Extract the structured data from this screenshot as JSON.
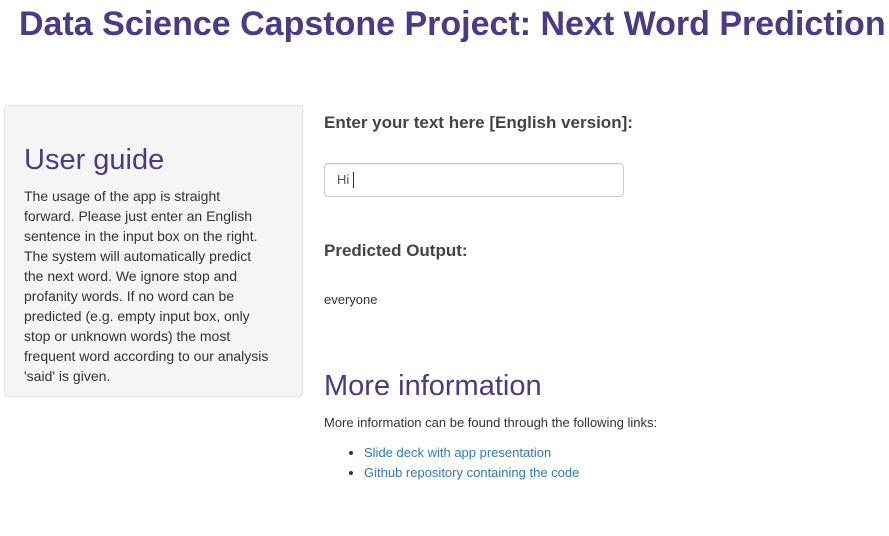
{
  "header": {
    "title": "Data Science Capstone Project: Next Word Prediction"
  },
  "sidebar": {
    "title": "User guide",
    "text": "The usage of the app is straight forward. Please just enter an English sentence in the input box on the right. The system will automatically predict the next word. We ignore stop and profanity words. If no word can be predicted (e.g. empty input box, only stop or unknown words) the most frequent word according to our analysis 'said' is given."
  },
  "main": {
    "input_label": "Enter your text here [English version]:",
    "input_value": "Hi",
    "output_label": "Predicted Output:",
    "output_value": "everyone",
    "more_title": "More information",
    "more_text": "More information can be found through the following links:",
    "links": [
      {
        "label": "Slide deck with app presentation"
      },
      {
        "label": "Github repository containing the code"
      }
    ]
  },
  "colors": {
    "heading": "#4b3a86",
    "link": "#337ab7",
    "well_background": "#f5f5f5"
  }
}
